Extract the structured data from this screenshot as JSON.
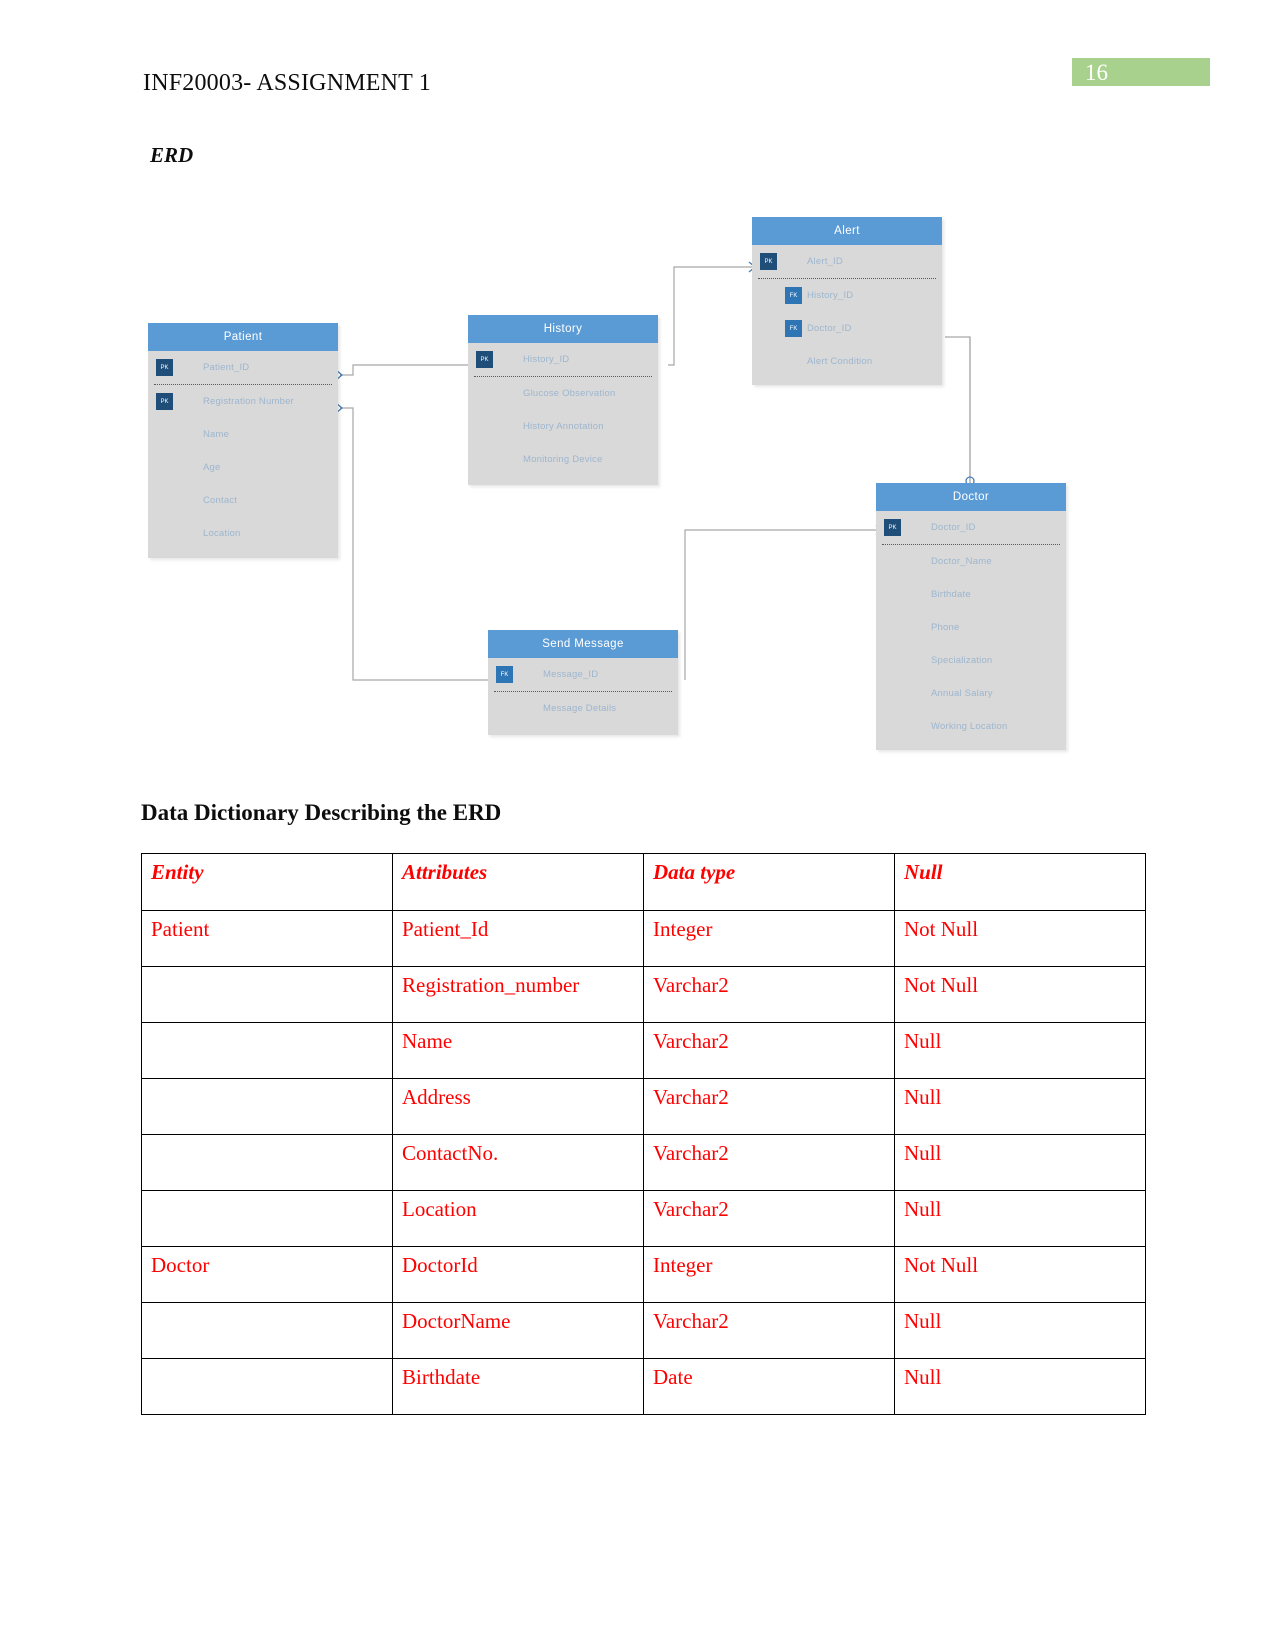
{
  "header": {
    "title": "INF20003- ASSIGNMENT 1",
    "page_number": "16",
    "badge_color": "#a9d18e"
  },
  "erd": {
    "section_label": "ERD",
    "header_color": "#5b9bd5",
    "body_color": "#d9d9d9",
    "pk_badge_color": "#1f4e79",
    "fk_badge_color": "#2e75b6",
    "entities": [
      {
        "name": "Patient",
        "attributes": [
          {
            "key": "PK",
            "name": "Patient_ID"
          },
          {
            "key": "PK",
            "name": "Registration Number"
          },
          {
            "key": "",
            "name": "Name"
          },
          {
            "key": "",
            "name": "Age"
          },
          {
            "key": "",
            "name": "Contact"
          },
          {
            "key": "",
            "name": "Location"
          }
        ]
      },
      {
        "name": "History",
        "attributes": [
          {
            "key": "PK",
            "name": "History_ID"
          },
          {
            "key": "",
            "name": "Glucose Observation"
          },
          {
            "key": "",
            "name": "History Annotation"
          },
          {
            "key": "",
            "name": "Monitoring Device"
          }
        ]
      },
      {
        "name": "Alert",
        "attributes": [
          {
            "key": "PK",
            "name": "Alert_ID"
          },
          {
            "key": "FK",
            "name": "History_ID"
          },
          {
            "key": "FK",
            "name": "Doctor_ID"
          },
          {
            "key": "",
            "name": "Alert Condition"
          }
        ]
      },
      {
        "name": "Doctor",
        "attributes": [
          {
            "key": "PK",
            "name": "Doctor_ID"
          },
          {
            "key": "",
            "name": "Doctor_Name"
          },
          {
            "key": "",
            "name": "Birthdate"
          },
          {
            "key": "",
            "name": "Phone"
          },
          {
            "key": "",
            "name": "Specialization"
          },
          {
            "key": "",
            "name": "Annual Salary"
          },
          {
            "key": "",
            "name": "Working Location"
          }
        ]
      },
      {
        "name": "Send Message",
        "attributes": [
          {
            "key": "FK",
            "name": "Message_ID"
          },
          {
            "key": "",
            "name": "Message Details"
          }
        ]
      }
    ]
  },
  "data_dictionary": {
    "title": "Data Dictionary Describing the ERD",
    "text_color": "#ff0000",
    "columns": [
      "Entity",
      "Attributes",
      "Data type",
      "Null"
    ],
    "rows": [
      {
        "entity": "Patient",
        "attribute": "Patient_Id",
        "data_type": "Integer",
        "null": "Not Null"
      },
      {
        "entity": "",
        "attribute": "Registration_number",
        "data_type": "Varchar2",
        "null": "Not Null"
      },
      {
        "entity": "",
        "attribute": "Name",
        "data_type": "Varchar2",
        "null": "Null"
      },
      {
        "entity": "",
        "attribute": "Address",
        "data_type": "Varchar2",
        "null": "Null"
      },
      {
        "entity": "",
        "attribute": "ContactNo.",
        "data_type": "Varchar2",
        "null": "Null"
      },
      {
        "entity": "",
        "attribute": "Location",
        "data_type": "Varchar2",
        "null": "Null"
      },
      {
        "entity": "Doctor",
        "attribute": "DoctorId",
        "data_type": "Integer",
        "null": "Not Null"
      },
      {
        "entity": "",
        "attribute": "DoctorName",
        "data_type": "Varchar2",
        "null": "Null"
      },
      {
        "entity": "",
        "attribute": "Birthdate",
        "data_type": "Date",
        "null": "Null"
      }
    ]
  }
}
